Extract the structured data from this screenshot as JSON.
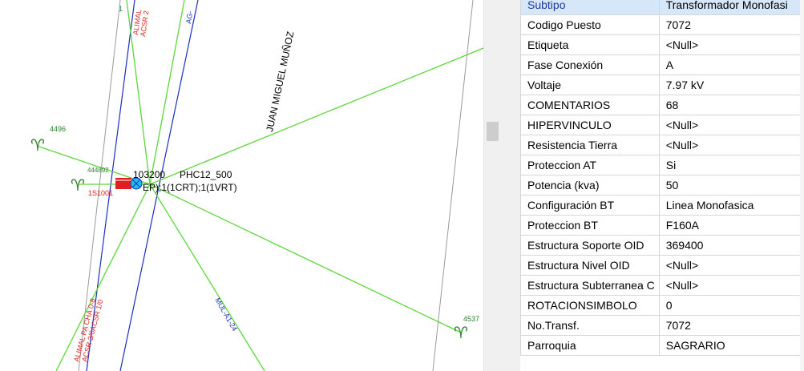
{
  "map": {
    "labels": {
      "street": "JUAN MIGUEL MUÑOZ",
      "node_4496": "4496",
      "node_444892": "444892",
      "node_1s100": "1S1001",
      "node_4537": "4537",
      "post_id": "103200",
      "post_type": "PHC12_500",
      "post_config": "EP);1(1CRT);1(1VRT)",
      "line_top_red": "ALIMAL",
      "line_top_red2": "ACSR 2",
      "line_top_blue": "AG-",
      "line_bottom_red": "ALIMAL PA CHA 0-8",
      "line_bottom_red2": "ACSR 3/0ACSR 1/0",
      "line_mid_blue": "MUL-A1-24",
      "top_small": "1"
    },
    "colors": {
      "green_line": "#5cd63a",
      "blue_line": "#1a2fbf",
      "gray_line": "#9a9a9a",
      "red_symbol": "#e02020",
      "cyan_symbol": "#22bde8",
      "node_text": "#2f7f2f"
    }
  },
  "properties": {
    "rows": [
      {
        "key": "Subtipo",
        "value": "Transformador Monofasi"
      },
      {
        "key": "Codigo Puesto",
        "value": "7072"
      },
      {
        "key": "Etiqueta",
        "value": "<Null>"
      },
      {
        "key": "Fase Conexión",
        "value": "A"
      },
      {
        "key": "Voltaje",
        "value": "7.97 kV"
      },
      {
        "key": "COMENTARIOS",
        "value": "68"
      },
      {
        "key": "HIPERVINCULO",
        "value": "<Null>"
      },
      {
        "key": "Resistencia Tierra",
        "value": "<Null>"
      },
      {
        "key": "Proteccion AT",
        "value": "Si"
      },
      {
        "key": "Potencia (kva)",
        "value": "50"
      },
      {
        "key": "Configuración BT",
        "value": "Linea Monofasica"
      },
      {
        "key": "Proteccion BT",
        "value": "F160A"
      },
      {
        "key": "Estructura Soporte OID",
        "value": "369400"
      },
      {
        "key": "Estructura Nivel OID",
        "value": "<Null>"
      },
      {
        "key": "Estructura Subterranea C",
        "value": "<Null>"
      },
      {
        "key": "ROTACIONSIMBOLO",
        "value": "0"
      },
      {
        "key": "No.Transf.",
        "value": "7072"
      },
      {
        "key": "Parroquia",
        "value": "SAGRARIO"
      }
    ]
  }
}
